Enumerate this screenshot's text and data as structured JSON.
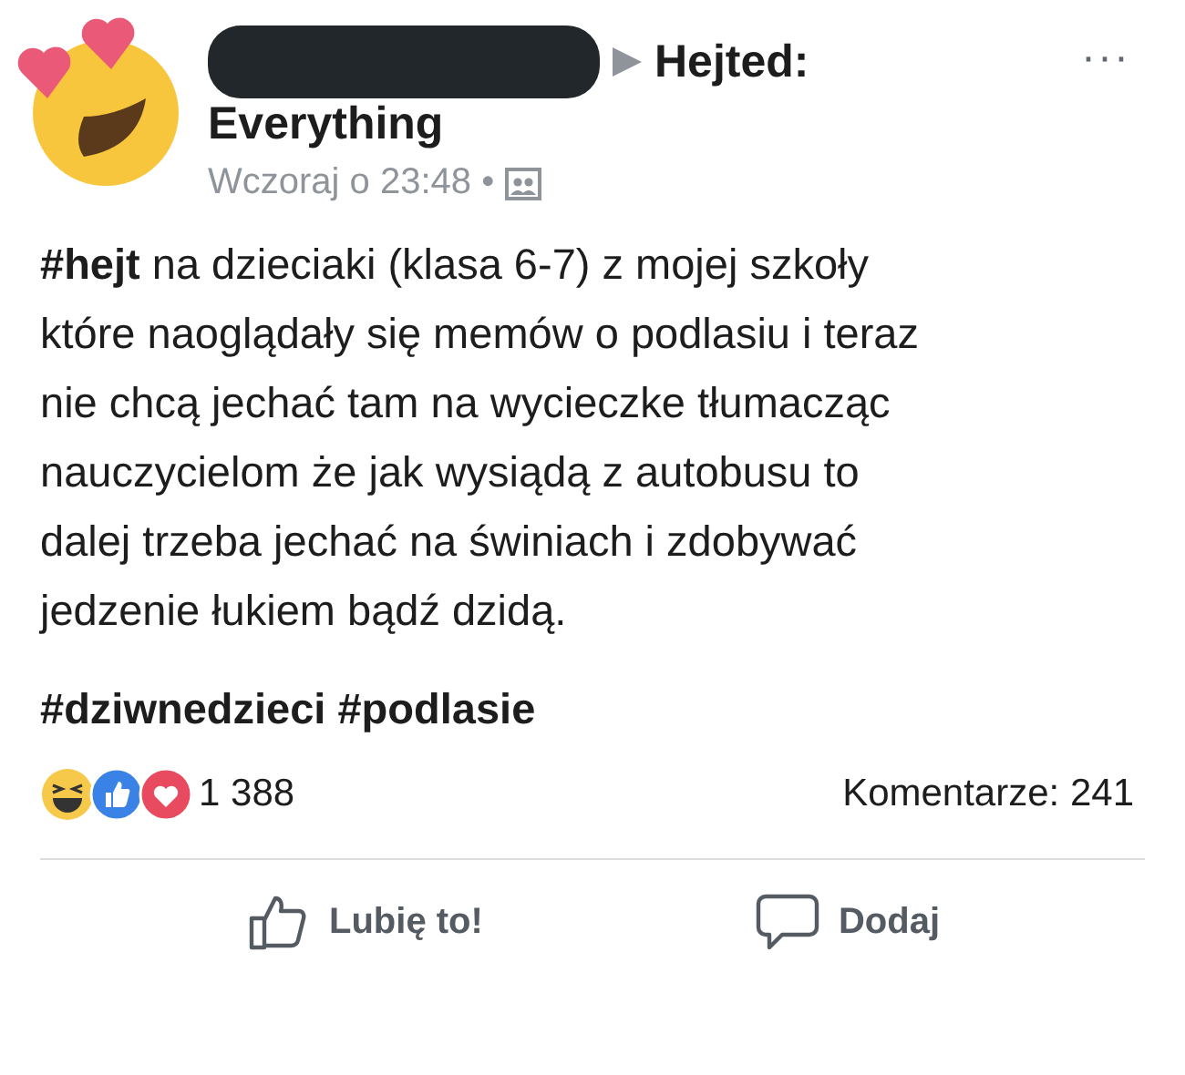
{
  "post": {
    "header_target": "Hejted:",
    "header_line2": "Everything",
    "timestamp": "Wczoraj o 23:48 •",
    "more": "···",
    "body": "**#hejt** na dzieciaki (klasa 6-7) z mojej szkoły\nktóre naoglądały się memów o podlasiu i teraz\nnie chcą jechać tam na wycieczke tłumacząc\nnauczycielom że jak wysiądą z autobusu to\ndalej trzeba jechać na świniach i zdobywać\njedzenie łukiem bądź dzidą.",
    "hashtags": "#dziwnedzieci #podlasie",
    "reactions": [
      {
        "kind": "haha"
      },
      {
        "kind": "like"
      },
      {
        "kind": "love"
      }
    ],
    "reaction_count": "1 388",
    "comments": "Komentarze: 241",
    "actions": [
      {
        "kind": "like",
        "label": "Lubię to!"
      },
      {
        "kind": "comment",
        "label": "Dodaj"
      }
    ]
  }
}
